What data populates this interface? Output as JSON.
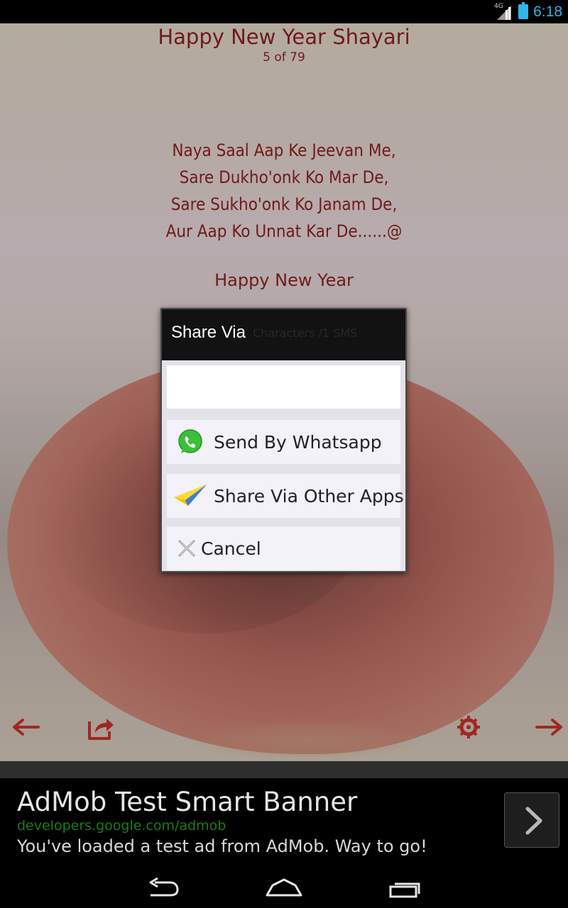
{
  "status_bar": {
    "network": "4G",
    "time": "6:18"
  },
  "page": {
    "title": "Happy New Year Shayari",
    "counter": "5 of 79",
    "shayari_lines": [
      "Naya Saal Aap Ke Jeevan Me,",
      "Sare Dukho'onk Ko Mar De,",
      "Sare Sukho'onk Ko Janam De,",
      "Aur Aap Ko Unnat Kar De......@"
    ],
    "greeting": "Happy New Year",
    "char_counter": "Characters /1 SMS"
  },
  "actions": {
    "prev_icon": "left-arrow-icon",
    "share_icon": "share-icon",
    "settings_icon": "gear-icon",
    "next_icon": "right-arrow-icon",
    "icon_color": "#b3231f"
  },
  "dialog": {
    "title": "Share Via",
    "options": [
      {
        "label": "Send By Whatsapp",
        "icon": "whatsapp-icon"
      },
      {
        "label": "Share Via Other Apps",
        "icon": "paper-plane-icon"
      },
      {
        "label": "Cancel",
        "icon": "close-icon"
      }
    ]
  },
  "ad": {
    "title": "AdMob Test Smart Banner",
    "url": "developers.google.com/admob",
    "description": "You've loaded a test ad from AdMob. Way to go!",
    "button_icon": "chevron-right-icon"
  },
  "nav_bar": {
    "back_icon": "back-icon",
    "home_icon": "home-icon",
    "recents_icon": "recents-icon"
  }
}
